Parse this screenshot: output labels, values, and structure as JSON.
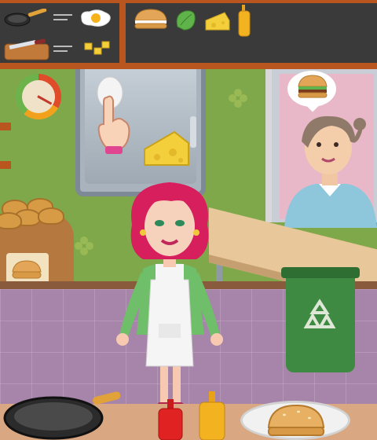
{
  "recipe": {
    "cook_steps": [
      {
        "tool": "frying-pan",
        "ingredient": "fried-egg"
      },
      {
        "tool": "cutting-board",
        "ingredient": "chopped-cheese"
      }
    ],
    "order_items": [
      "burger-bun",
      "lettuce",
      "cheese",
      "mustard-bottle"
    ]
  },
  "gauge": {
    "level_fraction": 0.33
  },
  "customer": {
    "order_icon": "burger-icon"
  },
  "colors": {
    "bar": "#3a3a3a",
    "wood": "#b9561f",
    "wall": "#7fa84a",
    "floor": "#a784a9",
    "bin": "#3f8a43"
  }
}
